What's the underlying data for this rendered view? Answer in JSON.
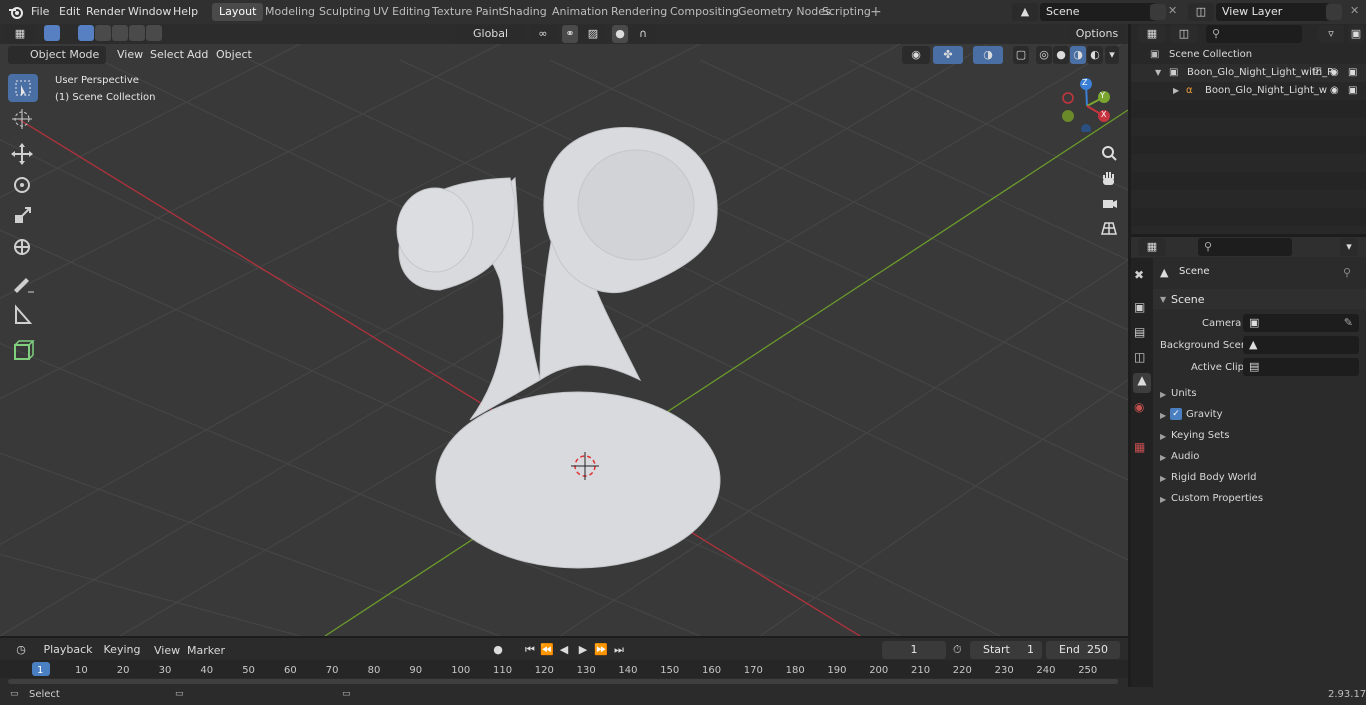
{
  "menubar": {
    "items": [
      "File",
      "Edit",
      "Render",
      "Window",
      "Help"
    ],
    "workspaces": [
      "Layout",
      "Modeling",
      "Sculpting",
      "UV Editing",
      "Texture Paint",
      "Shading",
      "Animation",
      "Rendering",
      "Compositing",
      "Geometry Nodes",
      "Scripting"
    ],
    "active_workspace": "Layout",
    "scene_name": "Scene",
    "view_layer": "View Layer"
  },
  "viewport_header": {
    "transform_orientation": "Global",
    "options_label": "Options",
    "mode": "Object Mode",
    "menus": [
      "View",
      "Select",
      "Add",
      "Object"
    ]
  },
  "viewport": {
    "perspective_label": "User Perspective",
    "collection_label": "(1) Scene Collection",
    "gizmo_axes": {
      "x": "X",
      "y": "Y",
      "z": "Z"
    },
    "colors": {
      "x_axis": "#c6343f",
      "y_axis": "#7aa630",
      "z_axis": "#3b7fd6",
      "background": "#393939",
      "object": "#d9dadd"
    }
  },
  "tools": [
    "select-box",
    "cursor",
    "move",
    "rotate",
    "scale",
    "transform",
    "annotate",
    "measure",
    "add-cube"
  ],
  "outliner": {
    "root": "Scene Collection",
    "items": [
      {
        "label": "Boon_Glo_Night_Light_with_R"
      },
      {
        "label": "Boon_Glo_Night_Light_w"
      }
    ]
  },
  "properties": {
    "context_title": "Scene",
    "panel_title": "Scene",
    "fields": [
      {
        "label": "Camera",
        "value": ""
      },
      {
        "label": "Background Scene",
        "value": ""
      },
      {
        "label": "Active Clip",
        "value": ""
      }
    ],
    "panels": [
      "Units",
      "Gravity",
      "Keying Sets",
      "Audio",
      "Rigid Body World",
      "Custom Properties"
    ],
    "gravity_checked": true
  },
  "timeline": {
    "menus": [
      "Playback",
      "Keying",
      "View",
      "Marker"
    ],
    "current_frame": "1",
    "start_label": "Start",
    "start_value": "1",
    "end_label": "End",
    "end_value": "250",
    "ticks": [
      "1",
      "10",
      "20",
      "30",
      "40",
      "50",
      "60",
      "70",
      "80",
      "90",
      "100",
      "110",
      "120",
      "130",
      "140",
      "150",
      "160",
      "170",
      "180",
      "190",
      "200",
      "210",
      "220",
      "230",
      "240",
      "250"
    ]
  },
  "statusbar": {
    "left_text": "Select",
    "version": "2.93.17"
  }
}
